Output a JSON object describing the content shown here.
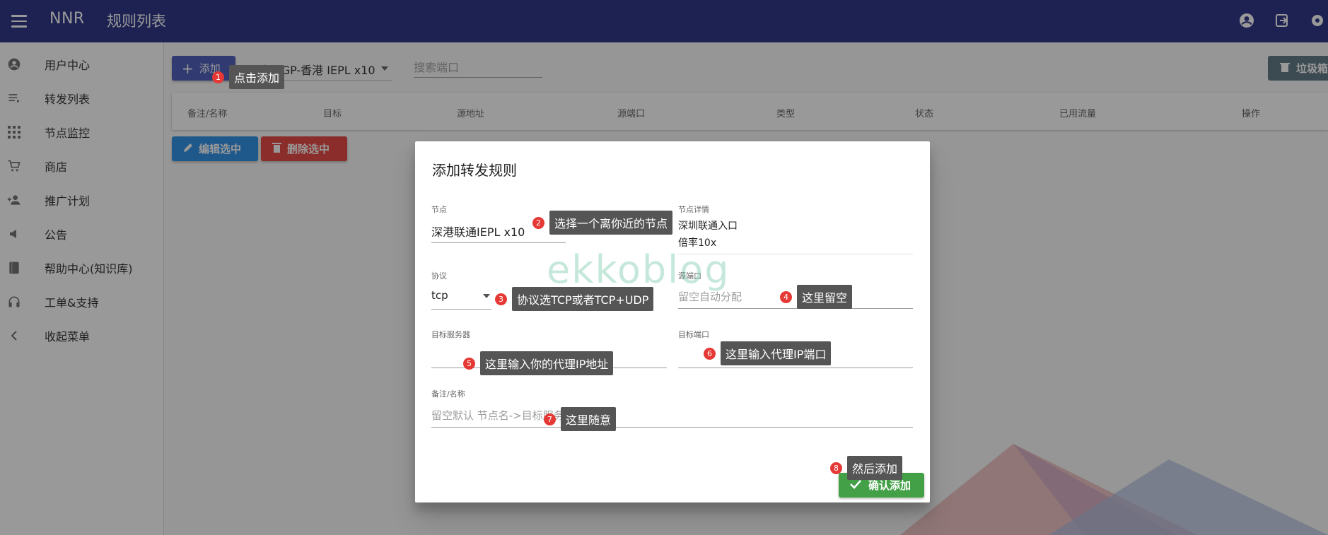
{
  "appbar": {
    "brand": "NNR",
    "page_title": "规则列表",
    "bg_color": "#1a237e",
    "icons": [
      "menu-icon",
      "account-icon",
      "logout-icon",
      "settings-icon"
    ]
  },
  "sidebar": {
    "items": [
      {
        "label": "用户中心",
        "icon": "account-circle-icon"
      },
      {
        "label": "转发列表",
        "icon": "list-icon"
      },
      {
        "label": "节点监控",
        "icon": "grid-icon"
      },
      {
        "label": "商店",
        "icon": "cart-icon"
      },
      {
        "label": "推广计划",
        "icon": "person-add-icon"
      },
      {
        "label": "公告",
        "icon": "megaphone-icon"
      },
      {
        "label": "帮助中心(知识库)",
        "icon": "book-icon"
      },
      {
        "label": "工单&支持",
        "icon": "headset-icon"
      },
      {
        "label": "收起菜单",
        "icon": "chevron-left-icon"
      }
    ]
  },
  "toolbar": {
    "add_label": "添加",
    "node_select_value": "厦门BGP-香港 IEPL x10",
    "search_placeholder": "搜索端口",
    "trash_label": "垃圾箱"
  },
  "table": {
    "columns": [
      "备注/名称",
      "目标",
      "源地址",
      "源端口",
      "类型",
      "状态",
      "已用流量",
      "操作"
    ]
  },
  "bulk": {
    "edit_label": "编辑选中",
    "delete_label": "删除选中"
  },
  "dialog": {
    "title": "添加转发规则",
    "node_label": "节点",
    "node_value": "深港联通IEPL x10",
    "node_detail_label": "节点详情",
    "node_detail_line1": "深圳联通入口",
    "node_detail_line2": "倍率10x",
    "protocol_label": "协议",
    "protocol_value": "tcp",
    "source_port_label": "源端口",
    "source_port_placeholder": "留空自动分配",
    "target_server_label": "目标服务器",
    "target_port_label": "目标端口",
    "remark_label": "备注/名称",
    "remark_placeholder": "留空默认 节点名->目标服务器",
    "confirm_label": "确认添加"
  },
  "watermark": "ekkoblog",
  "annotations": [
    {
      "num": "1",
      "text": "点击添加"
    },
    {
      "num": "2",
      "text": "选择一个离你近的节点"
    },
    {
      "num": "3",
      "text": "协议选TCP或者TCP+UDP"
    },
    {
      "num": "4",
      "text": "这里留空"
    },
    {
      "num": "5",
      "text": "这里输入你的代理IP地址"
    },
    {
      "num": "6",
      "text": "这里输入代理IP端口"
    },
    {
      "num": "7",
      "text": "这里随意"
    },
    {
      "num": "8",
      "text": "然后添加"
    }
  ],
  "colors": {
    "primary": "#3f51b5",
    "edit": "#1e88e5",
    "delete": "#e53935",
    "confirm": "#43a047",
    "trash": "#546e7a",
    "badge": "#e53935",
    "tooltip": "#555555"
  }
}
